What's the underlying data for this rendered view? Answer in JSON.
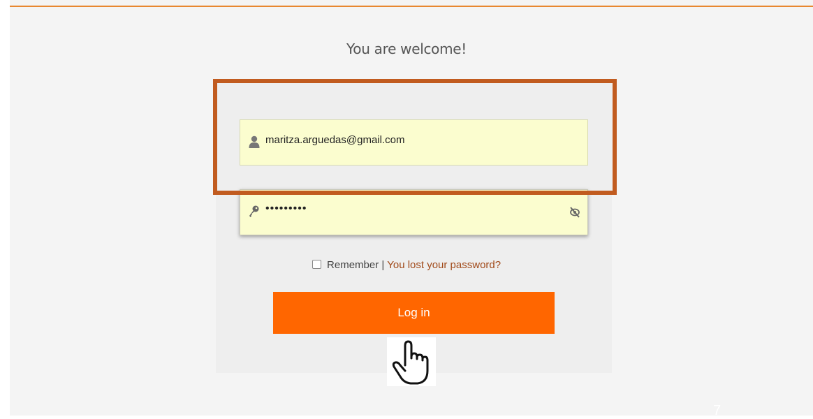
{
  "header": {
    "welcome_text": "You are welcome!"
  },
  "form": {
    "email": {
      "value": "maritza.arguedas@gmail.com",
      "icon": "user-icon"
    },
    "password": {
      "value": "•••••••••",
      "icon": "key-icon",
      "toggle_icon": "eye-slash-icon"
    },
    "remember_label": "Remember",
    "separator": "|",
    "lost_password_link": "You lost your password?",
    "login_label": "Log in"
  },
  "slide": {
    "page_number": "7"
  },
  "colors": {
    "accent": "#ff6600",
    "highlight": "#c15b1f",
    "field_bg": "#fbfdcf",
    "link": "#a14a1a"
  }
}
